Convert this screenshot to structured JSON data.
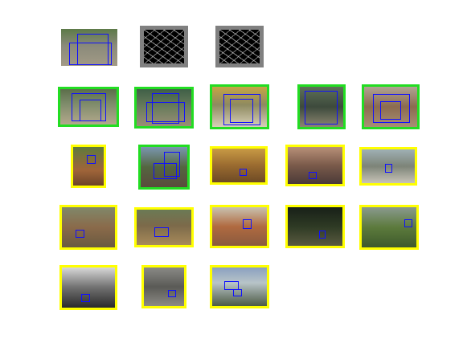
{
  "colors": {
    "positive_frame": "#22dd22",
    "negative_frame": "#ffff00",
    "detection_box": "#1010ff",
    "feature_bg": "#000000",
    "feature_border": "#808080"
  },
  "rows": [
    {
      "name": "template-row",
      "items": [
        {
          "kind": "photo",
          "frame": "none",
          "bg": "linear-gradient(180deg,#5d7a48 0%,#8a8a7a 45%,#a29a86 100%)",
          "boxes": [
            [
              0.28,
              0.12,
              0.56,
              0.85
            ],
            [
              0.14,
              0.38,
              0.76,
              0.6
            ]
          ]
        },
        {
          "kind": "feature",
          "frame": "gray"
        },
        {
          "kind": "feature",
          "frame": "gray"
        }
      ]
    },
    {
      "name": "green-row",
      "items": [
        {
          "kind": "photo",
          "frame": "positive",
          "bg": "linear-gradient(180deg,#5b6e4a 0%,#7d8b6a 40%,#b4a88c 100%)",
          "boxes": [
            [
              0.2,
              0.12,
              0.62,
              0.8
            ],
            [
              0.34,
              0.3,
              0.38,
              0.62
            ]
          ]
        },
        {
          "kind": "photo",
          "frame": "positive",
          "bg": "linear-gradient(180deg,#3f5f47 0%,#6b7d5d 50%,#9a8e76 100%)",
          "boxes": [
            [
              0.28,
              0.1,
              0.5,
              0.82
            ],
            [
              0.18,
              0.35,
              0.7,
              0.55
            ]
          ]
        },
        {
          "kind": "photo",
          "frame": "positive",
          "bg": "linear-gradient(180deg,#c5a545 0%,#8e8a60 45%,#d8d0b8 100%)",
          "boxes": [
            [
              0.2,
              0.18,
              0.68,
              0.78
            ],
            [
              0.32,
              0.3,
              0.42,
              0.6
            ]
          ]
        },
        {
          "kind": "photo",
          "frame": "positive",
          "bg": "linear-gradient(180deg,#5e7058 0%,#3d4a3c 50%,#8c8670 100%)",
          "boxes": [
            [
              0.12,
              0.1,
              0.76,
              0.84
            ]
          ]
        },
        {
          "kind": "photo",
          "frame": "positive",
          "bg": "linear-gradient(180deg,#b1a393 0%,#8b6b4f 50%,#a88f74 100%)",
          "boxes": [
            [
              0.16,
              0.18,
              0.7,
              0.72
            ],
            [
              0.3,
              0.35,
              0.4,
              0.45
            ]
          ]
        }
      ]
    },
    {
      "name": "yellow-row-1",
      "items": [
        {
          "kind": "photo",
          "frame": "positive-yellow",
          "bg": "linear-gradient(180deg,#5f7a3d 0%,#a0653a 60%,#6c4428 100%)",
          "boxes": [
            [
              0.45,
              0.2,
              0.3,
              0.22
            ]
          ]
        },
        {
          "kind": "photo",
          "frame": "positive",
          "bg": "linear-gradient(180deg,#7a96b0 0%,#546640 50%,#5a4a3c 100%)",
          "boxes": [
            [
              0.5,
              0.12,
              0.34,
              0.62
            ],
            [
              0.28,
              0.4,
              0.5,
              0.4
            ]
          ]
        },
        {
          "kind": "photo",
          "frame": "negative",
          "bg": "linear-gradient(180deg,#c89a45 0%,#9a6b30 50%,#6d4a25 100%)",
          "boxes": [
            [
              0.52,
              0.6,
              0.14,
              0.22
            ]
          ]
        },
        {
          "kind": "photo",
          "frame": "negative",
          "bg": "linear-gradient(180deg,#b89078 0%,#7a5a4a 50%,#4a3a38 100%)",
          "boxes": [
            [
              0.38,
              0.68,
              0.14,
              0.2
            ]
          ]
        },
        {
          "kind": "photo",
          "frame": "negative",
          "bg": "linear-gradient(180deg,#9fb0b4 0%,#7d8478 50%,#c8c4b8 100%)",
          "boxes": [
            [
              0.44,
              0.42,
              0.14,
              0.26
            ]
          ]
        }
      ]
    },
    {
      "name": "yellow-row-2",
      "items": [
        {
          "kind": "photo",
          "frame": "negative",
          "bg": "linear-gradient(180deg,#80886a 0%,#8a6a4a 50%,#6a5a40 100%)",
          "boxes": [
            [
              0.26,
              0.55,
              0.16,
              0.2
            ]
          ]
        },
        {
          "kind": "photo",
          "frame": "negative",
          "bg": "linear-gradient(180deg,#6b7a55 0%,#7c6a4a 45%,#a88a5a 100%)",
          "boxes": [
            [
              0.32,
              0.5,
              0.26,
              0.28
            ]
          ]
        },
        {
          "kind": "photo",
          "frame": "negative",
          "bg": "linear-gradient(180deg,#c9c2b0 0%,#b06a40 50%,#8a5a3e 100%)",
          "boxes": [
            [
              0.56,
              0.32,
              0.16,
              0.26
            ]
          ]
        },
        {
          "kind": "photo",
          "frame": "negative",
          "bg": "linear-gradient(180deg,#182018 0%,#2e3a24 50%,#5a5a40 100%)",
          "boxes": [
            [
              0.58,
              0.6,
              0.12,
              0.2
            ]
          ]
        },
        {
          "kind": "photo",
          "frame": "negative",
          "bg": "linear-gradient(180deg,#8a9a8e 0%,#5c7a3c 50%,#3e5a2c 100%)",
          "boxes": [
            [
              0.78,
              0.3,
              0.14,
              0.2
            ]
          ]
        }
      ]
    },
    {
      "name": "yellow-row-3",
      "items": [
        {
          "kind": "photo",
          "frame": "negative",
          "bg": "linear-gradient(180deg,#d8d8d8 0%,#707070 50%,#2a2a2a 100%)",
          "boxes": [
            [
              0.36,
              0.66,
              0.16,
              0.2
            ]
          ]
        },
        {
          "kind": "photo",
          "frame": "negative",
          "bg": "linear-gradient(180deg,#8a8a86 0%,#5a5a56 50%,#8c8a84 100%)",
          "boxes": [
            [
              0.6,
              0.58,
              0.2,
              0.18
            ]
          ]
        },
        {
          "kind": "photo",
          "frame": "negative",
          "bg": "linear-gradient(180deg,#8aa0c0 0%,#b8c4c8 40%,#4c5a44 100%)",
          "boxes": [
            [
              0.22,
              0.36,
              0.26,
              0.22
            ],
            [
              0.38,
              0.56,
              0.16,
              0.18
            ]
          ]
        }
      ]
    }
  ]
}
